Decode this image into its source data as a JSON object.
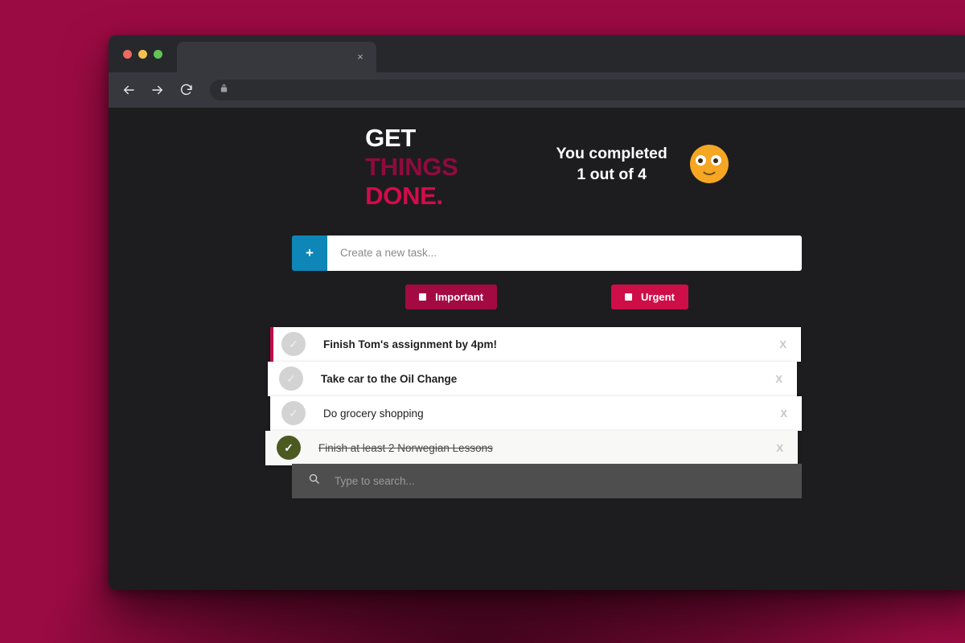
{
  "desktop": {
    "background_color": "#9B0B43"
  },
  "browser": {
    "tab": {
      "title": "",
      "close_label": "×"
    },
    "toolbar": {
      "back_icon": "arrow-left-icon",
      "forward_icon": "arrow-right-icon",
      "reload_icon": "reload-icon",
      "lock_icon": "lock-icon",
      "url": ""
    }
  },
  "app": {
    "brand": {
      "line1": "GET",
      "line2": "THINGS",
      "line3": "DONE."
    },
    "brand_colors": {
      "line1": "#FFFFFF",
      "line2": "#8E0B3D",
      "line3": "#D40B4B"
    },
    "status": {
      "text": "You completed\n1 out of 4",
      "completed_count": 1,
      "total_count": 4,
      "face_icon": "smiley-face-icon",
      "face_color": "#F5A623"
    },
    "create": {
      "add_label": "+",
      "add_color": "#0E86B8",
      "input_value": "",
      "input_placeholder": "Create a new task..."
    },
    "filters": [
      {
        "label": "Important",
        "color": "#A30A42",
        "checked": false
      },
      {
        "label": "Urgent",
        "color": "#CE0E47",
        "checked": false
      }
    ],
    "tasks": [
      {
        "label": "Finish Tom's assignment by 4pm!",
        "completed": false,
        "important": true,
        "bold": true,
        "check_icon": "check-icon",
        "delete_label": "X"
      },
      {
        "label": "Take car to the Oil Change",
        "completed": false,
        "important": false,
        "bold": true,
        "check_icon": "check-icon",
        "delete_label": "X"
      },
      {
        "label": "Do grocery shopping",
        "completed": false,
        "important": false,
        "bold": false,
        "check_icon": "check-icon",
        "delete_label": "X"
      },
      {
        "label": "Finish at least 2 Norwegian Lessons",
        "completed": true,
        "important": false,
        "bold": false,
        "check_icon": "check-icon",
        "delete_label": "X"
      }
    ],
    "search": {
      "icon": "search-icon",
      "value": "",
      "placeholder": "Type to search..."
    }
  }
}
